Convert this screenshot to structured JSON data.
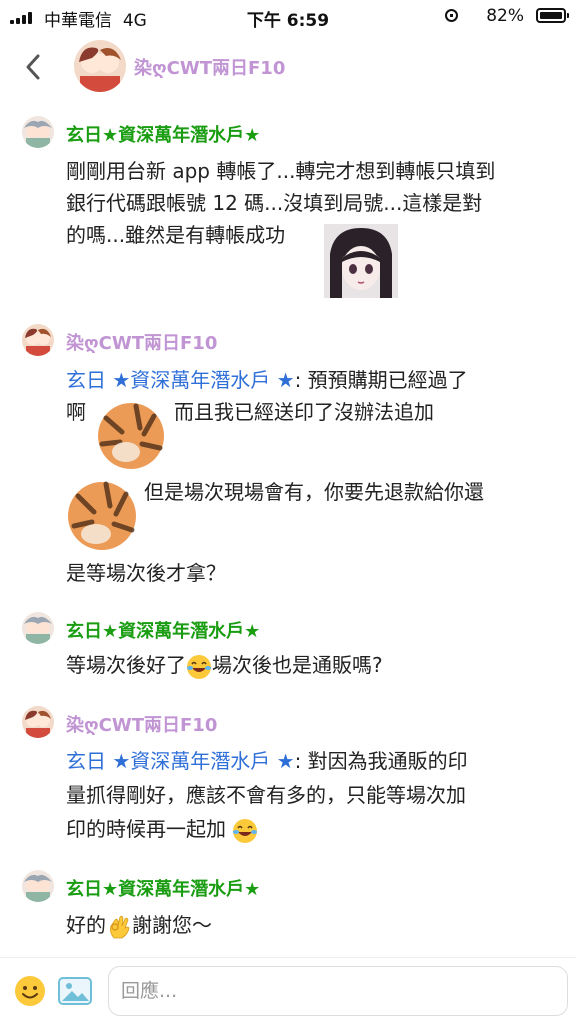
{
  "status_bar": {
    "carrier": "中華電信",
    "network": "4G",
    "time": "下午 6:59",
    "battery": "82%"
  },
  "header": {
    "title": "染ღCWT兩日F10"
  },
  "messages": [
    {
      "author": "玄日★資深萬年潛水戶★",
      "lines": [
        "剛剛用台新 app 轉帳了...轉完才想到轉帳只填到",
        "銀行代碼跟帳號 12 碼...沒填到局號...這樣是對",
        "的嗎...雖然是有轉帳成功"
      ]
    },
    {
      "author": "染ღCWT兩日F10",
      "mention": "玄日 ★資深萬年潛水戶 ★",
      "line1_rest": ": 預預購期已經過了",
      "line2a": "啊",
      "line2b": "而且我已經送印了沒辦法追加",
      "line3": "但是場次現場會有，你要先退款給你還",
      "line4": "是等場次後才拿？"
    },
    {
      "author": "玄日★資深萬年潛水戶★",
      "part1": "等場次後好了",
      "part2": "場次後也是通販嗎?"
    },
    {
      "author": "染ღCWT兩日F10",
      "mention": "玄日 ★資深萬年潛水戶 ★",
      "line1_rest": ": 對因為我通販的印",
      "line2": "量抓得剛好，應該不會有多的，只能等場次加",
      "line3": "印的時候再一起加"
    },
    {
      "author": "玄日★資深萬年潛水戶★",
      "part1": "好的",
      "part2": "謝謝您～"
    }
  ],
  "composer": {
    "placeholder": "回應..."
  },
  "colors": {
    "author_green": "#1a9d12",
    "author_purple": "#c195d4",
    "mention_blue": "#2f6fd8"
  },
  "icons": [
    "back-icon",
    "lock-rotation-icon",
    "battery-icon",
    "signal-icon",
    "laughing-tears-emoji",
    "ok-hand-emoji",
    "smile-icon",
    "image-icon"
  ]
}
